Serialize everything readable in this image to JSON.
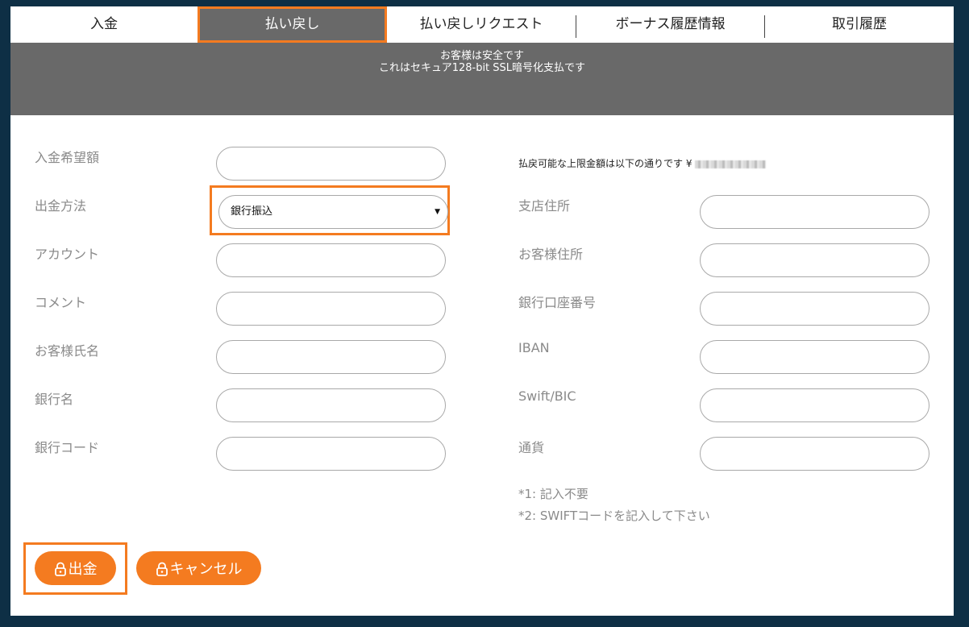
{
  "tabs": [
    {
      "label": "入金",
      "active": false
    },
    {
      "label": "払い戻し",
      "active": true
    },
    {
      "label": "払い戻しリクエスト",
      "active": false
    },
    {
      "label": "ボーナス履歴情報",
      "active": false
    },
    {
      "label": "取引履歴",
      "active": false
    }
  ],
  "banner": {
    "line1": "お客様は安全です",
    "line2": "これはセキュア128-bit SSL暗号化支払です"
  },
  "left_fields": [
    {
      "label": "入金希望額",
      "value": ""
    },
    {
      "label": "出金方法",
      "value": "銀行振込"
    },
    {
      "label": "アカウント",
      "value": ""
    },
    {
      "label": "コメント",
      "value": ""
    },
    {
      "label": "お客様氏名",
      "value": ""
    },
    {
      "label": "銀行名",
      "value": ""
    },
    {
      "label": "銀行コード",
      "value": ""
    }
  ],
  "limit_text": "払戻可能な上限金額は以下の通りです ¥",
  "right_fields": [
    {
      "label": "支店住所",
      "value": ""
    },
    {
      "label": "お客様住所",
      "value": ""
    },
    {
      "label": "銀行口座番号",
      "value": ""
    },
    {
      "label": "IBAN",
      "value": ""
    },
    {
      "label": "Swift/BIC",
      "value": ""
    },
    {
      "label": "通貨",
      "value": ""
    }
  ],
  "notes": [
    "*1: 記入不要",
    "*2: SWIFTコードを記入して下さい"
  ],
  "buttons": {
    "submit_label": "出金",
    "cancel_label": "キャンセル"
  },
  "colors": {
    "accent": "#f47b20",
    "banner": "#696969",
    "background": "#0e2f45"
  }
}
